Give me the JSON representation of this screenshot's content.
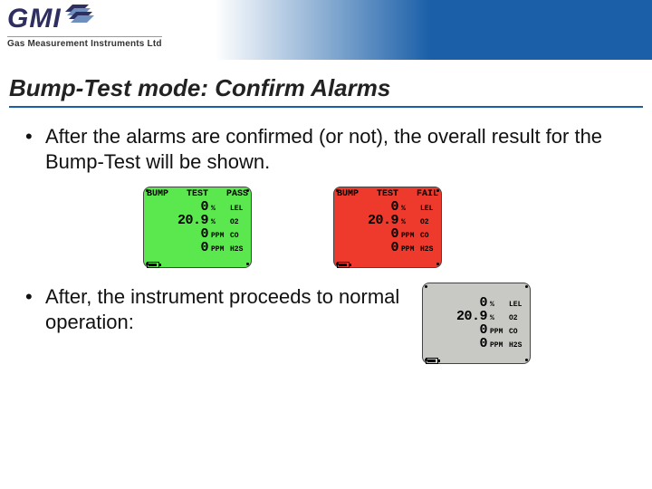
{
  "header": {
    "logo_text": "GMI",
    "logo_sub": "Gas Measurement Instruments Ltd"
  },
  "title": "Bump-Test mode: Confirm Alarms",
  "bullets": {
    "b1": "After the alarms are confirmed (or not), the overall result for the Bump-Test will be shown.",
    "b2": "After, the instrument proceeds to normal operation:"
  },
  "screens": {
    "pass": {
      "header_l": "BUMP",
      "header_m": "TEST",
      "header_r": "PASS",
      "rows": [
        {
          "val": "0",
          "unit": "%",
          "gas": "LEL"
        },
        {
          "val": "20.9",
          "unit": "%",
          "gas": "O2"
        },
        {
          "val": "0",
          "unit": "PPM",
          "gas": "CO"
        },
        {
          "val": "0",
          "unit": "PPM",
          "gas": "H2S"
        }
      ]
    },
    "fail": {
      "header_l": "BUMP",
      "header_m": "TEST",
      "header_r": "FAIL",
      "rows": [
        {
          "val": "0",
          "unit": "%",
          "gas": "LEL"
        },
        {
          "val": "20.9",
          "unit": "%",
          "gas": "O2"
        },
        {
          "val": "0",
          "unit": "PPM",
          "gas": "CO"
        },
        {
          "val": "0",
          "unit": "PPM",
          "gas": "H2S"
        }
      ]
    },
    "normal": {
      "rows": [
        {
          "val": "0",
          "unit": "%",
          "gas": "LEL"
        },
        {
          "val": "20.9",
          "unit": "%",
          "gas": "O2"
        },
        {
          "val": "0",
          "unit": "PPM",
          "gas": "CO"
        },
        {
          "val": "0",
          "unit": "PPM",
          "gas": "H2S"
        }
      ]
    }
  }
}
